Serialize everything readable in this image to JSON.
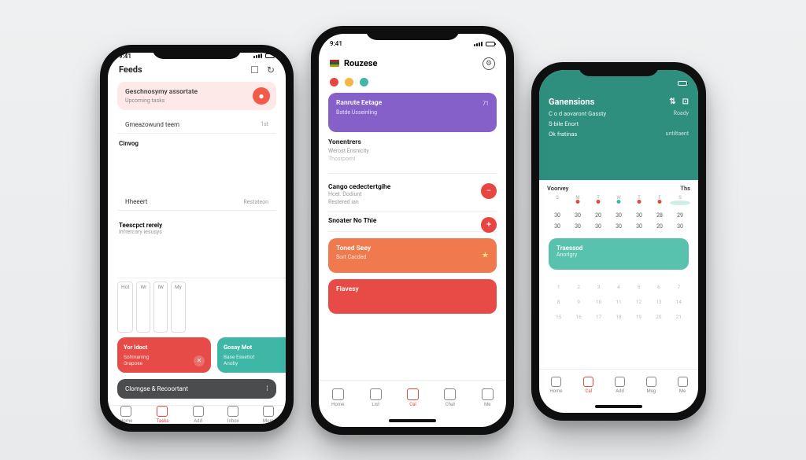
{
  "colors": {
    "accent_red": "#e64b47",
    "accent_teal": "#3fb7a6",
    "accent_teal_dark": "#2e8f7f",
    "accent_purple": "#8460c8",
    "accent_orange": "#f07a4e",
    "neutral_dark": "#4a4c4e"
  },
  "phone1": {
    "title": "Feeds",
    "hero": {
      "title": "Geschnosymy assortate",
      "subtitle": "Upcoming tasks"
    },
    "row1": {
      "label": "Gmeazowund teem",
      "meta": "1st"
    },
    "section_label": "Cinvog",
    "row2": {
      "label": "Hheeert",
      "meta": "Restateon"
    },
    "block": {
      "title": "Teescpct rerely",
      "subtitle": "Infrercary iesusys"
    },
    "chips": [
      "Hot",
      "Wr",
      "IW",
      "My"
    ],
    "cards": [
      {
        "title": "Yor Idoct",
        "subtitle": "Sohinaning",
        "sub2": "Grapose"
      },
      {
        "title": "Gosay Mot",
        "subtitle": "Base Essetiot",
        "sub2": "Anoby"
      }
    ],
    "dark": {
      "title": "Clomgse & Recoortant"
    },
    "nav": [
      "Home",
      "Tasks",
      "Add",
      "Inbox",
      "More"
    ]
  },
  "phone2": {
    "title": "Rouzese",
    "dot_colors": [
      "#e64540",
      "#f5b547",
      "#3fb7a6"
    ],
    "purple": {
      "title": "Ranrute Eetage",
      "meta": "71",
      "subtitle": "Batde  Usseinling"
    },
    "block1": {
      "title": "Yonentrers",
      "subtitle": "Werost  Ensnicity",
      "sub2": "Thosrpomt"
    },
    "rows": [
      {
        "title": "Cango cedectertgihe",
        "subtitle": "Hcet. Dodiunt",
        "meta": "Restered  ian"
      },
      {
        "title": "Snoater No Thie",
        "subtitle": "",
        "meta": ""
      }
    ],
    "orange": {
      "title": "Toned Seey",
      "subtitle": "Sort Cacded"
    },
    "red": {
      "title": "Flavesy"
    },
    "nav": [
      "Home",
      "List",
      "Cal",
      "Chat",
      "Me"
    ]
  },
  "phone3": {
    "title": "Ganensions",
    "lines": [
      {
        "label": "C o d aovaront Gassty",
        "value": "Roady"
      },
      {
        "label": "S-bile  Enort",
        "value": ""
      },
      {
        "label": "Ok fratinas",
        "value": "untiltaent"
      }
    ],
    "month": {
      "label": "Voorvey",
      "meta": "Ths"
    },
    "dow": [
      "S",
      "M",
      "T",
      "W",
      "T",
      "F",
      "S"
    ],
    "weeks": [
      [
        "",
        "",
        "",
        "",
        "",
        "",
        ""
      ],
      [
        "",
        "",
        "",
        "",
        "",
        "",
        ""
      ],
      [
        "30",
        "30",
        "20",
        "30",
        "30",
        "28",
        "29"
      ],
      [
        "30",
        "30",
        "30",
        "30",
        "30",
        "20",
        "30"
      ]
    ],
    "dot_markers_week1": [
      1,
      2,
      4,
      5
    ],
    "teal_dot_week1": [
      3
    ],
    "selected_week1": 6,
    "teal_card": {
      "title": "Traessod",
      "subtitle": "Anorlgry"
    },
    "grid_tail": [
      "1",
      "2",
      "3",
      "4",
      "5",
      "6",
      "7",
      "8",
      "9",
      "10",
      "11",
      "12",
      "13",
      "14",
      "15",
      "16",
      "17",
      "18",
      "19",
      "20",
      "21"
    ],
    "nav": [
      "Home",
      "Cal",
      "Add",
      "Msg",
      "Me"
    ]
  }
}
